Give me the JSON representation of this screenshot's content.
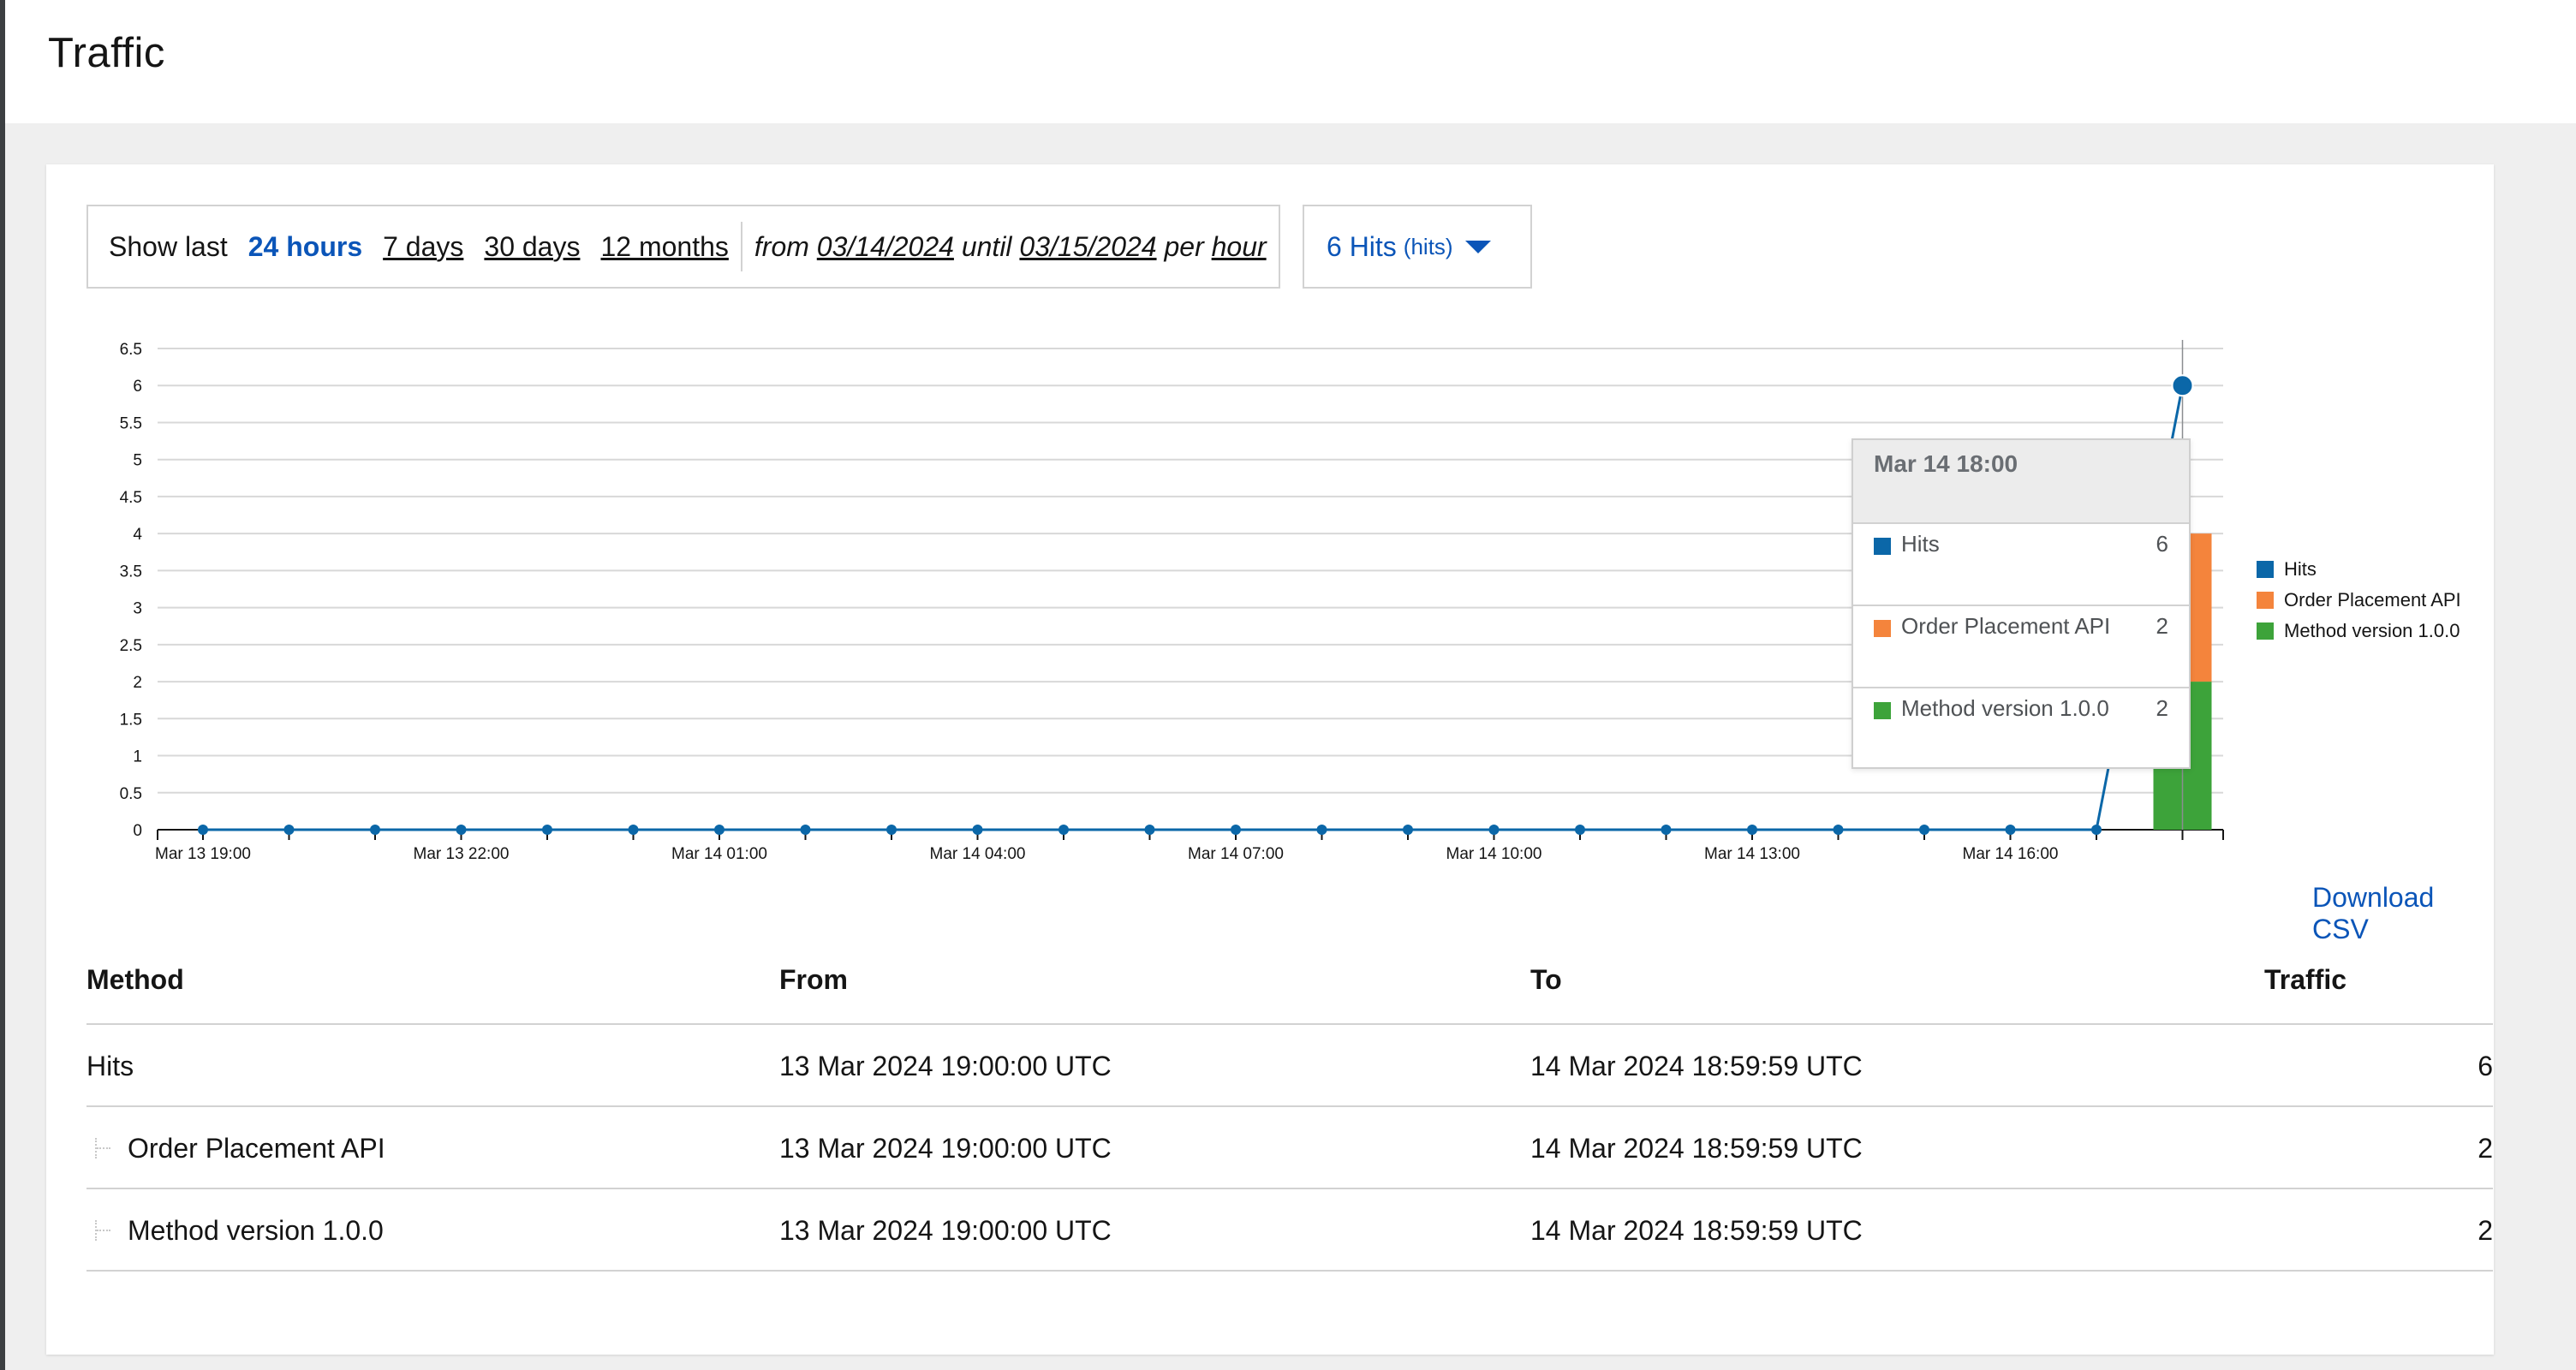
{
  "page": {
    "title": "Traffic"
  },
  "toolbar": {
    "show_last_label": "Show last",
    "ranges": [
      "24 hours",
      "7 days",
      "30 days",
      "12 months"
    ],
    "active_range": "24 hours",
    "from_label": "from",
    "from_date": "03/14/2024",
    "until_label": "until",
    "until_date": "03/15/2024",
    "per_label": "per",
    "granularity": "hour"
  },
  "metric_select": {
    "label": "6 Hits",
    "unit": "(hits)",
    "icon": "caret-down-icon"
  },
  "chart_data": {
    "type": "line",
    "y_ticks": [
      "0",
      "0.5",
      "1",
      "1.5",
      "2",
      "2.5",
      "3",
      "3.5",
      "4",
      "4.5",
      "5",
      "5.5",
      "6",
      "6.5"
    ],
    "ylim": [
      0,
      6.5
    ],
    "x_tick_labels": [
      "Mar 13 19:00",
      "Mar 13 22:00",
      "Mar 14 01:00",
      "Mar 14 04:00",
      "Mar 14 07:00",
      "Mar 14 10:00",
      "Mar 14 13:00",
      "Mar 14 16:00"
    ],
    "x": [
      "Mar 13 19:00",
      "Mar 13 20:00",
      "Mar 13 21:00",
      "Mar 13 22:00",
      "Mar 13 23:00",
      "Mar 14 00:00",
      "Mar 14 01:00",
      "Mar 14 02:00",
      "Mar 14 03:00",
      "Mar 14 04:00",
      "Mar 14 05:00",
      "Mar 14 06:00",
      "Mar 14 07:00",
      "Mar 14 08:00",
      "Mar 14 09:00",
      "Mar 14 10:00",
      "Mar 14 11:00",
      "Mar 14 12:00",
      "Mar 14 13:00",
      "Mar 14 14:00",
      "Mar 14 15:00",
      "Mar 14 16:00",
      "Mar 14 17:00",
      "Mar 14 18:00"
    ],
    "series": [
      {
        "name": "Hits",
        "kind": "line",
        "color": "#0b67a8",
        "values": [
          0,
          0,
          0,
          0,
          0,
          0,
          0,
          0,
          0,
          0,
          0,
          0,
          0,
          0,
          0,
          0,
          0,
          0,
          0,
          0,
          0,
          0,
          0,
          6
        ]
      },
      {
        "name": "Order Placement API",
        "kind": "stacked-bar",
        "color": "#f4843c",
        "values": [
          0,
          0,
          0,
          0,
          0,
          0,
          0,
          0,
          0,
          0,
          0,
          0,
          0,
          0,
          0,
          0,
          0,
          0,
          0,
          0,
          0,
          0,
          0,
          2
        ]
      },
      {
        "name": "Method version 1.0.0",
        "kind": "stacked-bar",
        "color": "#3da33a",
        "values": [
          0,
          0,
          0,
          0,
          0,
          0,
          0,
          0,
          0,
          0,
          0,
          0,
          0,
          0,
          0,
          0,
          0,
          0,
          0,
          0,
          0,
          0,
          0,
          2
        ]
      }
    ],
    "legend": [
      "Hits",
      "Order Placement API",
      "Method version 1.0.0"
    ],
    "legend_position": "right",
    "grid": true
  },
  "tooltip": {
    "title": "Mar 14 18:00",
    "rows": [
      {
        "name": "Hits",
        "value": "6",
        "color": "#0b67a8"
      },
      {
        "name": "Order Placement API",
        "value": "2",
        "color": "#f4843c"
      },
      {
        "name": "Method version 1.0.0",
        "value": "2",
        "color": "#3da33a"
      }
    ]
  },
  "download_label": "Download CSV",
  "table": {
    "headers": [
      "Method",
      "From",
      "To",
      "Traffic"
    ],
    "rows": [
      {
        "method": "Hits",
        "from": "13 Mar 2024 19:00:00 UTC",
        "to": "14 Mar 2024 18:59:59 UTC",
        "traffic": "6"
      },
      {
        "method": "Order Placement API",
        "from": "13 Mar 2024 19:00:00 UTC",
        "to": "14 Mar 2024 18:59:59 UTC",
        "traffic": "2"
      },
      {
        "method": "Method version 1.0.0",
        "from": "13 Mar 2024 19:00:00 UTC",
        "to": "14 Mar 2024 18:59:59 UTC",
        "traffic": "2"
      }
    ]
  }
}
